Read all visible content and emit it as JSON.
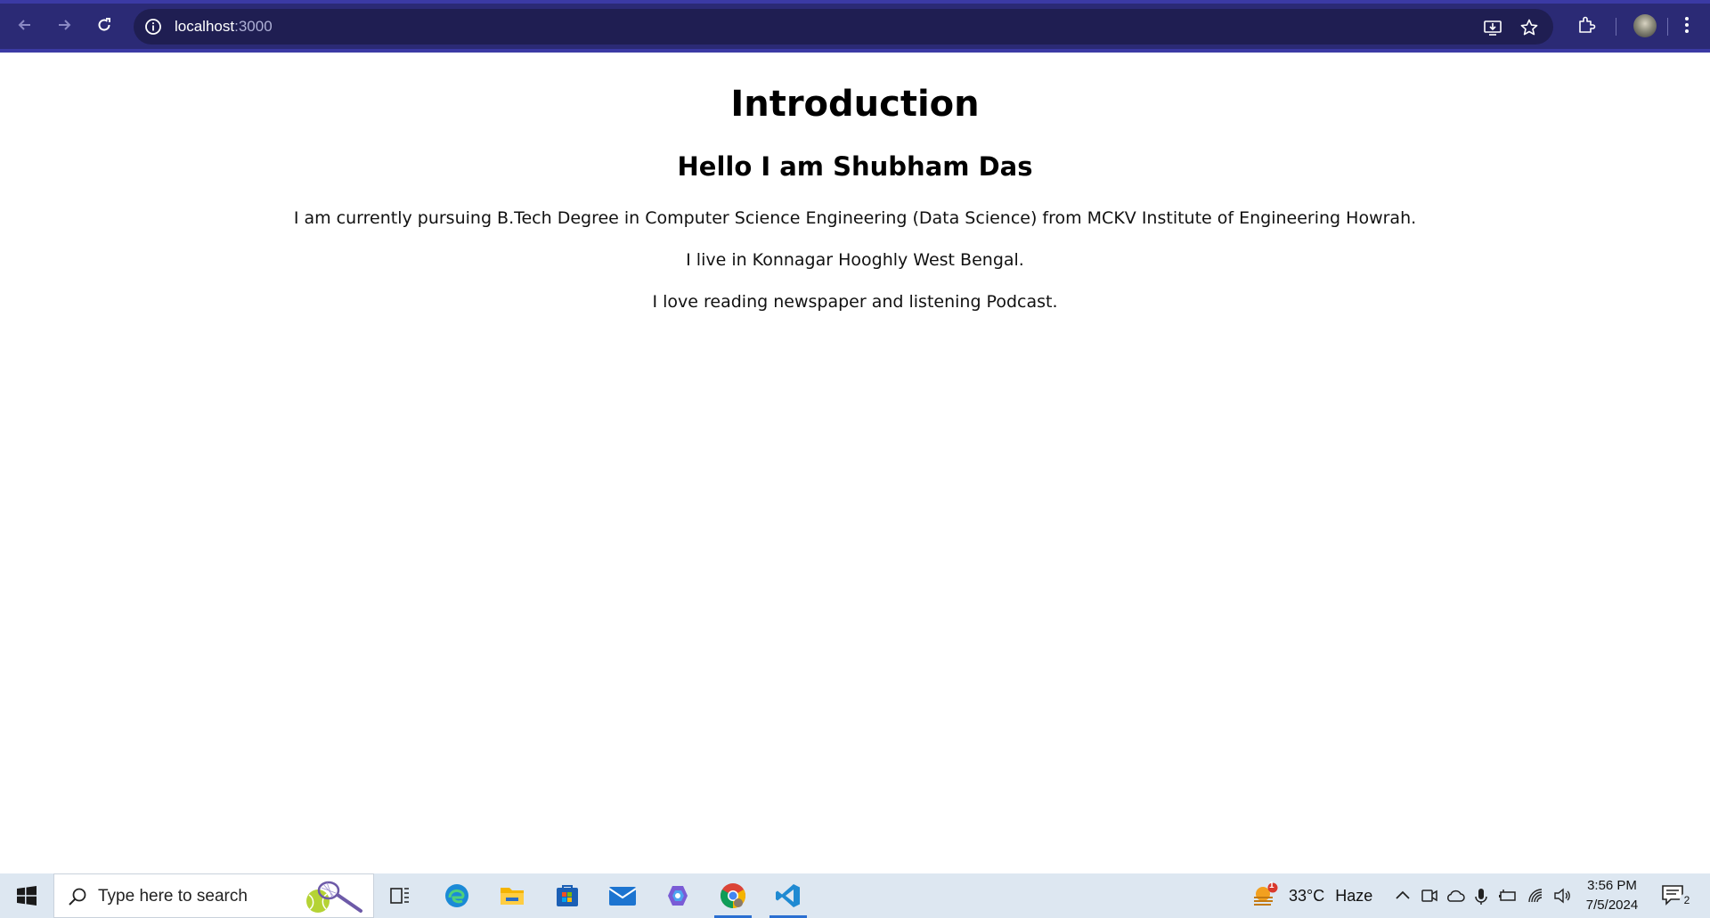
{
  "browser": {
    "url_host": "localhost",
    "url_port": ":3000"
  },
  "page": {
    "title": "Introduction",
    "subtitle": "Hello I am Shubham Das",
    "paragraphs": [
      "I am currently pursuing B.Tech Degree in Computer Science Engineering (Data Science) from MCKV Institute of Engineering Howrah.",
      "I live in Konnagar Hooghly West Bengal.",
      "I love reading newspaper and listening Podcast."
    ]
  },
  "taskbar": {
    "search_placeholder": "Type here to search",
    "weather_temp": "33°C",
    "weather_desc": "Haze",
    "weather_badge": "1",
    "time": "3:56 PM",
    "date": "7/5/2024",
    "notification_count": "2"
  },
  "colors": {
    "toolbar": "#2b2a75",
    "omnibox": "#1f1e52",
    "taskbar": "#dde7f1",
    "accent_indicator": "#2a6fd1"
  }
}
